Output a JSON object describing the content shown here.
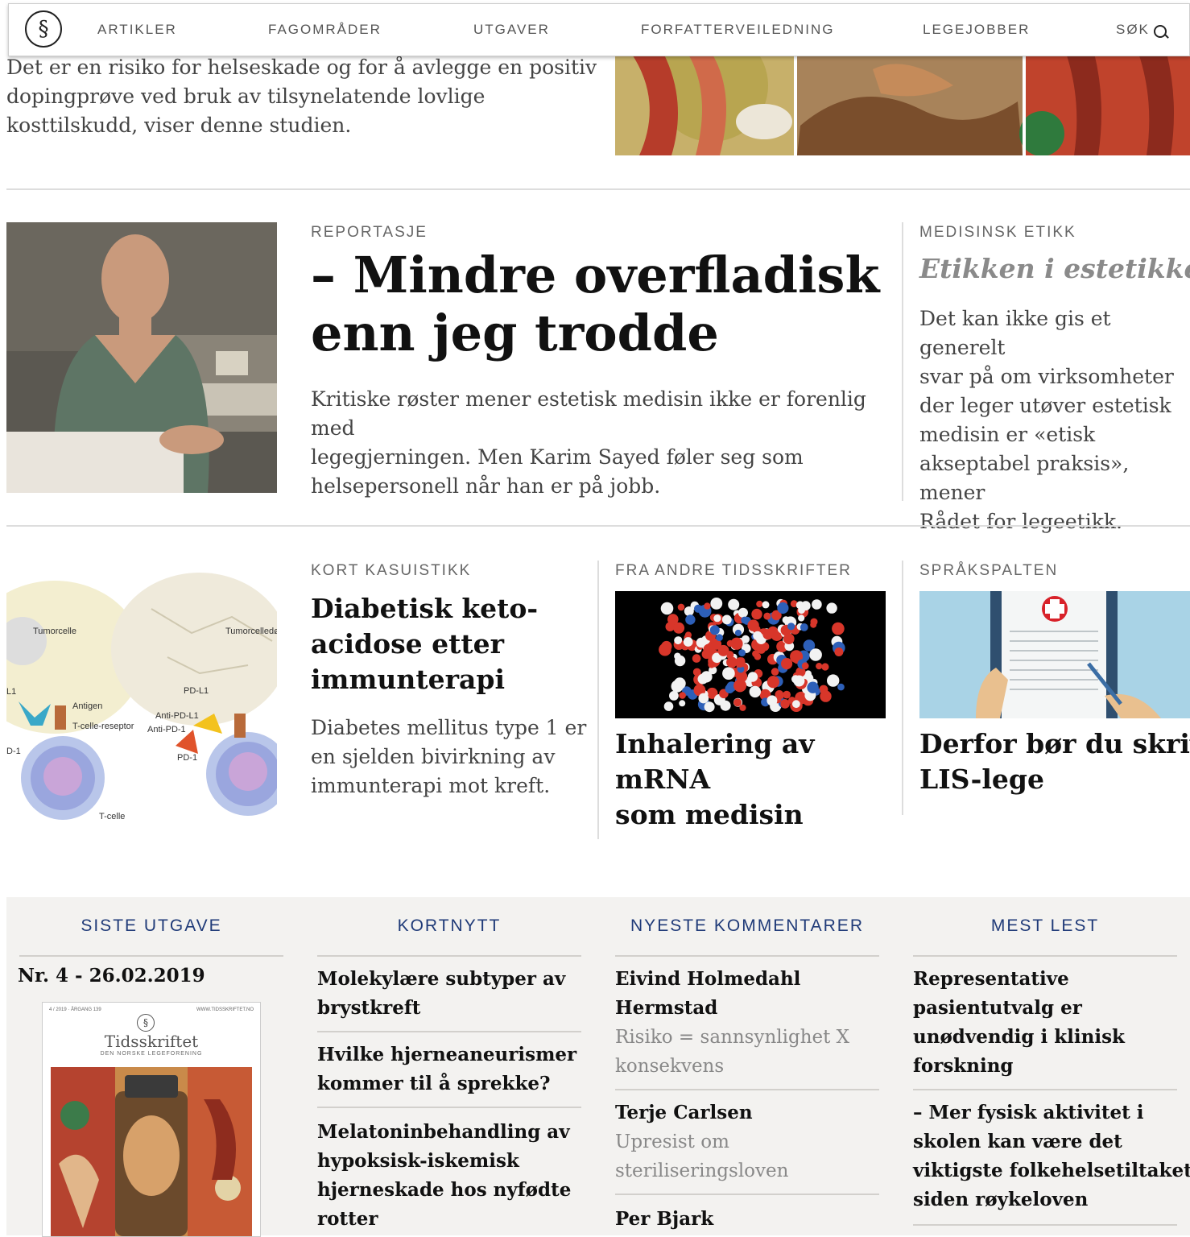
{
  "nav": {
    "items": [
      "ARTIKLER",
      "FAGOMRÅDER",
      "UTGAVER",
      "FORFATTERVEILEDNING",
      "LEGEJOBBER",
      "SØK"
    ],
    "logo_glyph": "§"
  },
  "top_article": {
    "lede_lines": [
      "Det er en risiko for helseskade og for å avlegge en positiv",
      "dopingprøve ved bruk av tilsynelatende lovlige",
      "kosttilskudd, viser denne studien."
    ]
  },
  "feature": {
    "kicker": "REPORTASJE",
    "title_lines": [
      "– Mindre overfladisk",
      "enn jeg trodde"
    ],
    "lede_lines": [
      "Kritiske røster mener estetisk medisin ikke er forenlig med",
      "legegjerningen. Men Karim Sayed føler seg som",
      "helsepersonell når han er på jobb."
    ]
  },
  "side_feature": {
    "kicker": "MEDISINSK ETIKK",
    "title": "Etikken i estetikken",
    "lede_lines": [
      "Det kan ikke gis et generelt",
      "svar på om virksomheter",
      "der leger utøver estetisk",
      "medisin er «etisk",
      "akseptabel praksis», mener",
      "Rådet for legeetikk."
    ]
  },
  "case": {
    "kicker": "KORT KASUISTIKK",
    "title_lines": [
      "Diabetisk keto-",
      "acidose etter",
      "immunterapi"
    ],
    "lede_lines": [
      "Diabetes mellitus type 1 er",
      "en sjelden bivirkning av",
      "immunterapi mot kreft."
    ],
    "illustration_labels": [
      "Tumorcelle",
      "Tumorcelledø",
      "L1",
      "Antigen",
      "T-celle-reseptor",
      "D-1",
      "T-celle",
      "PD-L1",
      "Anti-PD-L1",
      "Anti-PD-1",
      "PD-1"
    ]
  },
  "other_journals": {
    "kicker": "FRA ANDRE TIDSSKRIFTER",
    "title_lines": [
      "Inhalering av mRNA",
      "som medisin"
    ]
  },
  "language": {
    "kicker": "SPRÅKSPALTEN",
    "title_lines": [
      "Derfor bør du skrive",
      "LIS-lege"
    ]
  },
  "bottom": {
    "latest_issue": {
      "title": "SISTE UTGAVE",
      "issue": "Nr. 4 - 26.02.2019",
      "cover_brand": "Tidsskriftet",
      "cover_sub": "DEN NORSKE LEGEFORENING",
      "cover_left": "4 / 2019 · ÅRGANG 139",
      "cover_right": "WWW.TIDSSKRIFTET.NO"
    },
    "news": {
      "title": "KORTNYTT",
      "items": [
        [
          "Molekylære subtyper av",
          "brystkreft"
        ],
        [
          "Hvilke hjerneaneurismer",
          "kommer til å sprekke?"
        ],
        [
          "Melatoninbehandling av",
          "hypoksisk-iskemisk",
          "hjerneskade hos nyfødte",
          "rotter"
        ]
      ]
    },
    "comments": {
      "title": "NYESTE KOMMENTARER",
      "items": [
        {
          "author": [
            "Eivind Holmedahl",
            "Hermstad"
          ],
          "topic": [
            "Risiko = sannsynlighet X",
            "konsekvens"
          ]
        },
        {
          "author": [
            "Terje Carlsen"
          ],
          "topic": [
            "Upresist om",
            "steriliseringsloven"
          ]
        },
        {
          "author": [
            "Per Bjark"
          ],
          "topic": []
        }
      ]
    },
    "most_read": {
      "title": "MEST LEST",
      "items": [
        [
          "Representative",
          "pasientutvalg er",
          "unødvendig i klinisk",
          "forskning"
        ],
        [
          "– Mer fysisk aktivitet i",
          "skolen kan være det",
          "viktigste folkehelsetiltaket",
          "siden røykeloven"
        ]
      ]
    }
  }
}
